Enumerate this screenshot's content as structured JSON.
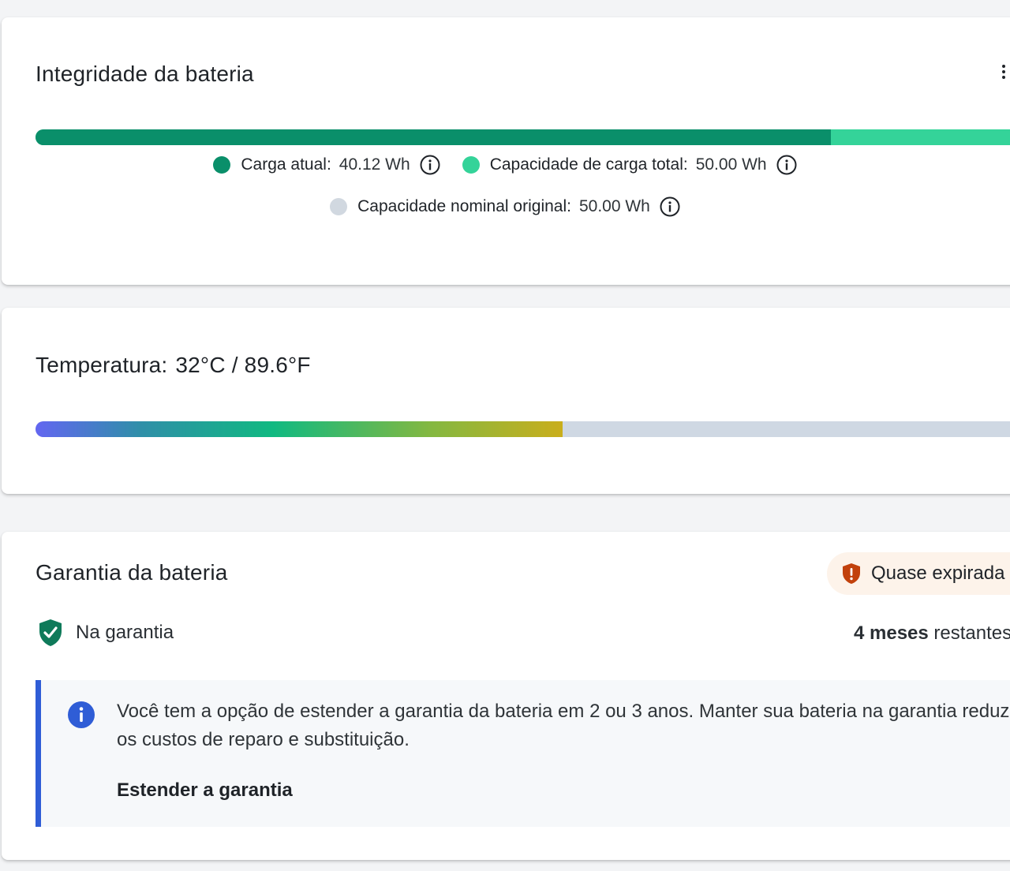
{
  "battery_health": {
    "title": "Integridade da bateria",
    "menu_icon": "more-vertical-icon",
    "current_charge_fraction": 0.8,
    "full_capacity_fraction": 1.0,
    "colors": {
      "current": "#0a8f6a",
      "full": "#34d399",
      "original": "#d1d8e0"
    },
    "legend": {
      "current": {
        "label": "Carga atual:",
        "value": "40.12 Wh",
        "icon": "info-icon"
      },
      "full": {
        "label": "Capacidade de carga total:",
        "value": "50.00 Wh",
        "icon": "info-icon"
      },
      "original": {
        "label": "Capacidade nominal original:",
        "value": "50.00 Wh",
        "icon": "info-icon"
      }
    }
  },
  "temperature": {
    "label": "Temperatura:",
    "value": "32°C / 89.6°F",
    "bar_fraction": 0.53
  },
  "warranty": {
    "title": "Garantia da bateria",
    "status_pill": {
      "icon": "shield-alert-icon",
      "text": "Quase expirada",
      "color": "#c2410c"
    },
    "coverage": {
      "icon": "shield-check-icon",
      "text": "Na garantia",
      "color": "#0f7a5a"
    },
    "remaining": {
      "count": "4 meses",
      "suffix": "restantes"
    },
    "info_box": {
      "icon": "info-circle-icon",
      "text": "Você tem a opção de estender a garantia da bateria em 2 ou 3 anos. Manter sua bateria na garantia reduz os custos de reparo e substituição.",
      "link": "Estender a garantia",
      "accent": "#2f5dd6"
    }
  }
}
